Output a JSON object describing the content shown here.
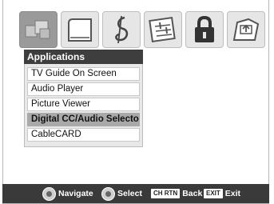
{
  "icon_bar": {
    "icons": [
      {
        "name": "applications-icon",
        "active": true
      },
      {
        "name": "picture-icon",
        "active": false
      },
      {
        "name": "audio-icon",
        "active": false
      },
      {
        "name": "setup-icon",
        "active": false
      },
      {
        "name": "lock-icon",
        "active": false
      },
      {
        "name": "preferences-icon",
        "active": false
      }
    ]
  },
  "menu": {
    "title": "Applications",
    "items": [
      {
        "label": "TV Guide On Screen"
      },
      {
        "label": "Audio Player"
      },
      {
        "label": "Picture Viewer"
      },
      {
        "label": "Digital CC/Audio Selector",
        "selected": true
      },
      {
        "label": "CableCARD"
      }
    ]
  },
  "help_bar": {
    "navigate_label": "Navigate",
    "select_label": "Select",
    "back_key": "CH RTN",
    "back_label": "Back",
    "exit_key": "EXIT",
    "exit_label": "Exit"
  },
  "colors": {
    "title_bar": "#3e3e3e",
    "selected_item": "#a9a9a9",
    "active_icon": "#9a9a9a",
    "help_bar": "#3a3a3a"
  }
}
